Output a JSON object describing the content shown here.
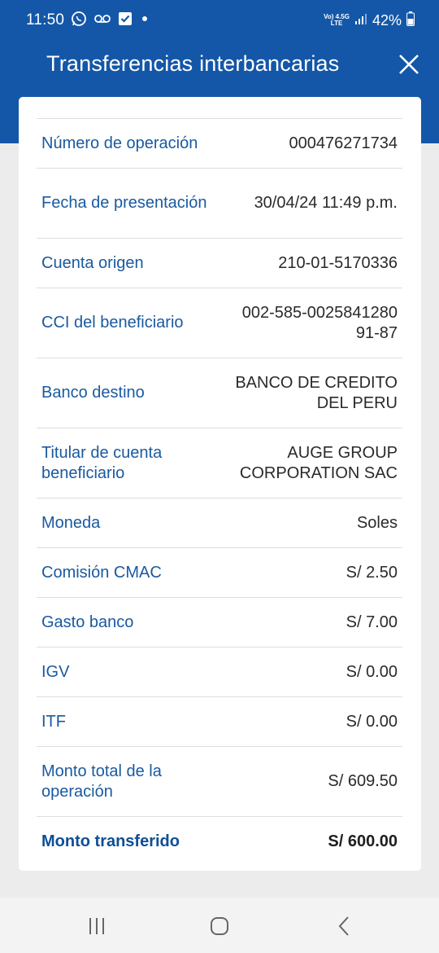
{
  "status_bar": {
    "time": "11:50",
    "net_top": "Vo) 4.5G",
    "net_bottom": "LTE",
    "battery": "42%"
  },
  "header": {
    "title": "Transferencias interbancarias",
    "close_icon": "close-icon"
  },
  "details": [
    {
      "label": "Número de operación",
      "value": "000476271734"
    },
    {
      "label": "Fecha de presentación",
      "value": "30/04/24 11:49 p.m."
    },
    {
      "label": "Cuenta origen",
      "value": "210-01-5170336"
    },
    {
      "label": "CCI del beneficiario",
      "value": "002-585-0025841280 91-87"
    },
    {
      "label": "Banco destino",
      "value": "BANCO DE CREDITO DEL PERU"
    },
    {
      "label": "Titular de cuenta beneficiario",
      "value": "AUGE GROUP CORPORATION SAC"
    },
    {
      "label": "Moneda",
      "value": "Soles"
    },
    {
      "label": "Comisión CMAC",
      "value": "S/ 2.50"
    },
    {
      "label": "Gasto banco",
      "value": "S/ 7.00"
    },
    {
      "label": "IGV",
      "value": "S/ 0.00"
    },
    {
      "label": "ITF",
      "value": "S/ 0.00"
    },
    {
      "label": "Monto total de la operación",
      "value": "S/ 609.50"
    },
    {
      "label": "Monto transferido",
      "value": "S/ 600.00"
    }
  ],
  "colors": {
    "brand_blue": "#1457a8",
    "label_blue": "#1a5aa0",
    "background": "#ececec"
  },
  "nav": {
    "recents_icon": "recents-icon",
    "home_icon": "home-icon",
    "back_icon": "back-icon"
  }
}
